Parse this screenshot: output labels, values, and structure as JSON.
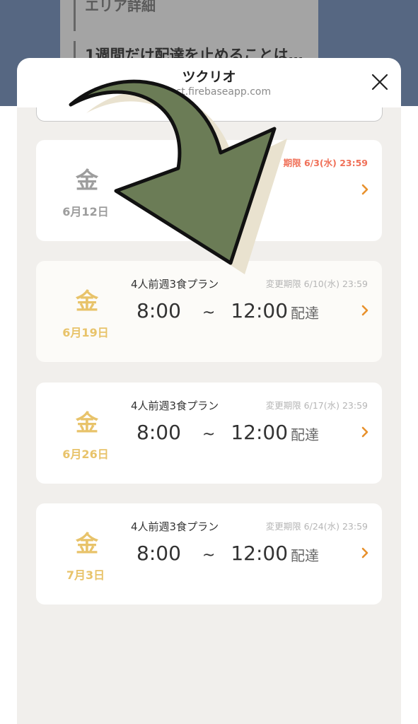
{
  "background": {
    "line1": "エリア詳細",
    "line2": "1週間だけ配達を止めることは…"
  },
  "sheet": {
    "title": "ツクリオ",
    "url": "product.firebaseapp.com",
    "close_icon": "close-icon"
  },
  "deliveries": [
    {
      "weekday": "金",
      "date": "6月12日",
      "deadline": "期限 6/3(水) 23:59"
    },
    {
      "weekday": "金",
      "date": "6月19日",
      "plan": "4人前週3食プラン",
      "deadline": "変更期限 6/10(水) 23:59",
      "time_start": "8:00",
      "tilde": "~",
      "time_end": "12:00",
      "delivery": "配達"
    },
    {
      "weekday": "金",
      "date": "6月26日",
      "plan": "4人前週3食プラン",
      "deadline": "変更期限 6/17(水) 23:59",
      "time_start": "8:00",
      "tilde": "~",
      "time_end": "12:00",
      "delivery": "配達"
    },
    {
      "weekday": "金",
      "date": "7月3日",
      "plan": "4人前週3食プラン",
      "deadline": "変更期限 6/24(水) 23:59",
      "time_start": "8:00",
      "tilde": "~",
      "time_end": "12:00",
      "delivery": "配達"
    }
  ],
  "colors": {
    "accent_gold": "#e8c36a",
    "chevron_orange": "#e8912c",
    "deadline_red": "#f07058",
    "annotation_arrow": "#6b7c56"
  }
}
